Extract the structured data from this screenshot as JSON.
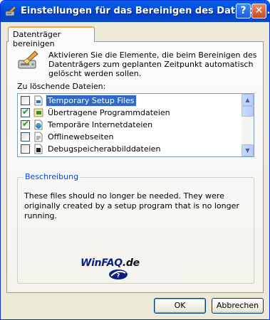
{
  "window": {
    "title": "Einstellungen für das Bereinigen des Datenträ...",
    "help_label": "?",
    "close_label": "✕"
  },
  "tab": {
    "label": "Datenträger bereinigen"
  },
  "intro": {
    "text": "Aktivieren Sie die Elemente, die beim Bereinigen des Datenträgers zum geplanten Zeitpunkt automatisch gelöscht werden sollen."
  },
  "files": {
    "label": "Zu löschende Dateien:",
    "items": [
      {
        "label": "Temporary Setup Files",
        "checked": false,
        "selected": true,
        "icon": "file-icon"
      },
      {
        "label": "Übertragene Programmdateien",
        "checked": true,
        "selected": false,
        "icon": "program-files-icon"
      },
      {
        "label": "Temporäre Internetdateien",
        "checked": true,
        "selected": false,
        "icon": "internet-files-icon"
      },
      {
        "label": "Offlinewebseiten",
        "checked": false,
        "selected": false,
        "icon": "offline-pages-icon"
      },
      {
        "label": "Debugspeicherabbilddateien",
        "checked": false,
        "selected": false,
        "icon": "debug-dump-icon"
      }
    ]
  },
  "description": {
    "title": "Beschreibung",
    "text": "These files should no longer be needed. They were originally created by a setup program that is no longer running.",
    "logo": {
      "part1": "WinFAQ",
      "part2": ".de"
    }
  },
  "buttons": {
    "ok": "OK",
    "cancel": "Abbrechen"
  },
  "colors": {
    "titlebar": "#0058e6",
    "selection": "#316ac5",
    "group_title": "#0046d5"
  }
}
